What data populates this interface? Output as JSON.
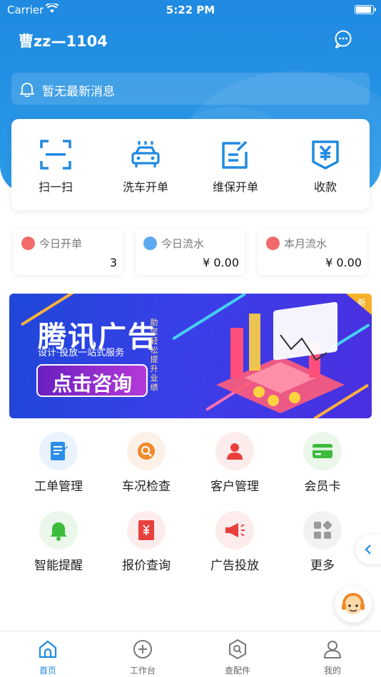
{
  "status_bar": {
    "carrier": "Carrier",
    "time": "5:22 PM"
  },
  "header": {
    "shop_name": "曹zz—1104",
    "message_icon": "chat-bubble-icon"
  },
  "notice": {
    "text": "暂无最新消息",
    "icon": "bell-icon"
  },
  "quick_actions": [
    {
      "label": "扫一扫",
      "icon": "scan-icon"
    },
    {
      "label": "洗车开单",
      "icon": "car-wash-icon"
    },
    {
      "label": "维保开单",
      "icon": "edit-note-icon"
    },
    {
      "label": "收款",
      "icon": "yuan-receipt-icon"
    }
  ],
  "stats": [
    {
      "title": "今日开单",
      "value": "3",
      "color": "#f26a6a",
      "icon": "order-icon"
    },
    {
      "title": "今日流水",
      "value": "¥ 0.00",
      "color": "#5da9f0",
      "icon": "card-icon"
    },
    {
      "title": "本月流水",
      "value": "¥ 0.00",
      "color": "#f26a6a",
      "icon": "layers-icon"
    }
  ],
  "banner": {
    "title": "腾讯广告",
    "subtitle": "设计·投放一站式服务",
    "cta": "点击咨询",
    "vertical_text": "助您轻松提升业绩",
    "badge": "新"
  },
  "grid": [
    {
      "label": "工单管理",
      "icon": "work-order-icon",
      "bg": "#eaf3fd",
      "fg": "#2d8ee8"
    },
    {
      "label": "车况检查",
      "icon": "search-magnifier-icon",
      "bg": "#fdf1e7",
      "fg": "#f08a2a"
    },
    {
      "label": "客户管理",
      "icon": "customer-icon",
      "bg": "#fdecec",
      "fg": "#e8403e"
    },
    {
      "label": "会员卡",
      "icon": "member-card-icon",
      "bg": "#eaf7ea",
      "fg": "#3cbb3c"
    },
    {
      "label": "智能提醒",
      "icon": "bell-reminder-icon",
      "bg": "#eaf7ea",
      "fg": "#3cbb3c"
    },
    {
      "label": "报价查询",
      "icon": "price-quote-icon",
      "bg": "#fdecec",
      "fg": "#e8403e"
    },
    {
      "label": "广告投放",
      "icon": "megaphone-icon",
      "bg": "#fdecec",
      "fg": "#e8403e"
    },
    {
      "label": "更多",
      "icon": "more-grid-icon",
      "bg": "#f2f2f2",
      "fg": "#9a9a9a"
    }
  ],
  "tabbar": [
    {
      "label": "首页",
      "icon": "home-icon",
      "active": true
    },
    {
      "label": "工作台",
      "icon": "plus-circle-icon",
      "active": false
    },
    {
      "label": "查配件",
      "icon": "parts-search-icon",
      "active": false
    },
    {
      "label": "我的",
      "icon": "user-icon",
      "active": false
    }
  ],
  "colors": {
    "primary": "#1f8ae0",
    "accent_red": "#e8403e"
  }
}
